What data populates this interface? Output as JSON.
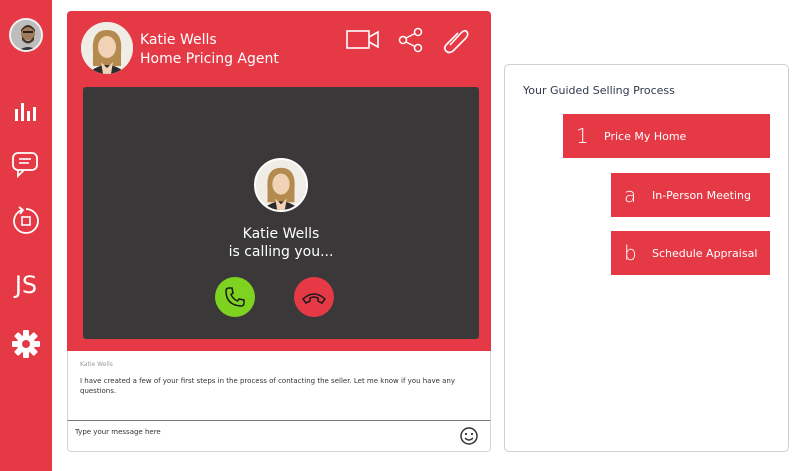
{
  "sidebar": {
    "js_label": "JS",
    "accent": "#e63946"
  },
  "agent": {
    "name": "Katie Wells",
    "role": "Home Pricing Agent"
  },
  "call": {
    "name": "Katie Wells",
    "status": "is calling you...",
    "accept_color": "#7ed321",
    "decline_color": "#e63946"
  },
  "messages": [
    {
      "sender": "Katie Wells",
      "text": "I have created a few of your first steps in the process of contacting the seller. Let me know if you have any questions."
    }
  ],
  "compose": {
    "placeholder": "Type your message here"
  },
  "guide": {
    "title": "Your Guided Selling Process",
    "steps": [
      {
        "num": "1",
        "label": "Price My Home"
      },
      {
        "num": "a",
        "label": "In-Person Meeting"
      },
      {
        "num": "b",
        "label": "Schedule Appraisal"
      }
    ]
  }
}
